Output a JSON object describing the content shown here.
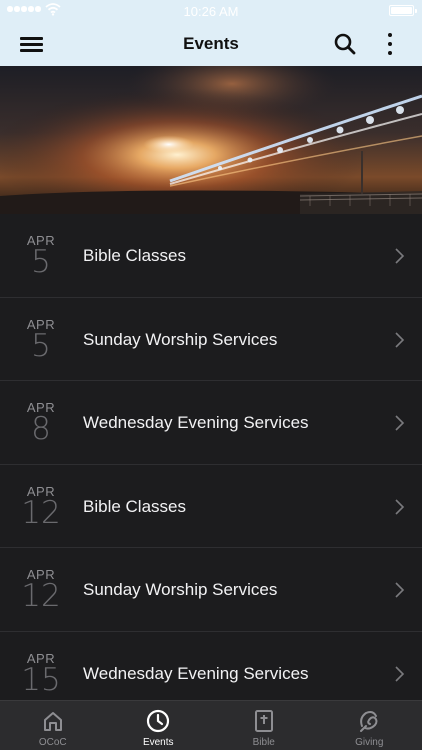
{
  "status_bar": {
    "time": "10:26 AM"
  },
  "nav": {
    "title": "Events"
  },
  "events": [
    {
      "month": "APR",
      "day": "5",
      "name": "Bible Classes"
    },
    {
      "month": "APR",
      "day": "5",
      "name": "Sunday Worship Services"
    },
    {
      "month": "APR",
      "day": "8",
      "name": "Wednesday Evening Services"
    },
    {
      "month": "APR",
      "day": "12",
      "name": "Bible Classes"
    },
    {
      "month": "APR",
      "day": "12",
      "name": "Sunday Worship Services"
    },
    {
      "month": "APR",
      "day": "15",
      "name": "Wednesday Evening Services"
    }
  ],
  "tabs": [
    {
      "label": "OCoC",
      "icon": "home-icon",
      "active": false
    },
    {
      "label": "Events",
      "icon": "clock-icon",
      "active": true
    },
    {
      "label": "Bible",
      "icon": "bible-icon",
      "active": false
    },
    {
      "label": "Giving",
      "icon": "giving-icon",
      "active": false
    }
  ],
  "colors": {
    "header_bg": "#dfeef7",
    "list_bg": "#1c1c1e",
    "tab_bar_bg": "#2c2c2e",
    "tab_active": "#ffffff",
    "tab_inactive": "#8e8e92"
  }
}
